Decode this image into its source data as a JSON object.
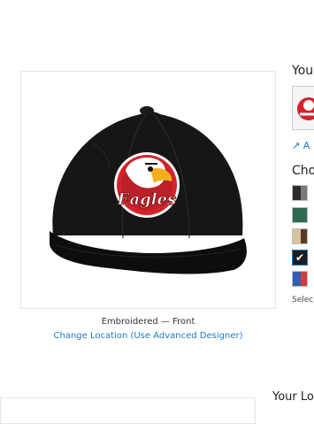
{
  "product": {
    "location_label": "Embroidered — Front",
    "change_location_link": "Change Location (Use Advanced Designer)",
    "logo_text": "Eagles"
  },
  "sidebar": {
    "your_logo_title": "You",
    "add_link": "A",
    "choose_title": "Cho",
    "swatch_hint": "Selec",
    "swatches": [
      {
        "left": "#2b2b2b",
        "right": "#7a7a7a",
        "selected": false
      },
      {
        "left": "#2f6b52",
        "right": "#2f6b52",
        "selected": false
      },
      {
        "left": "#d8c3a0",
        "right": "#5b3a25",
        "selected": false
      },
      {
        "left": "#1d1d1d",
        "right": "#1d1d1d",
        "selected": true
      },
      {
        "left": "#2f5fb3",
        "right": "#d43b3b",
        "selected": false
      }
    ]
  },
  "bottom": {
    "title": "Your Lo"
  },
  "colors": {
    "link": "#1f7ac4",
    "hat": "#111111",
    "logo_red": "#d6222b"
  }
}
